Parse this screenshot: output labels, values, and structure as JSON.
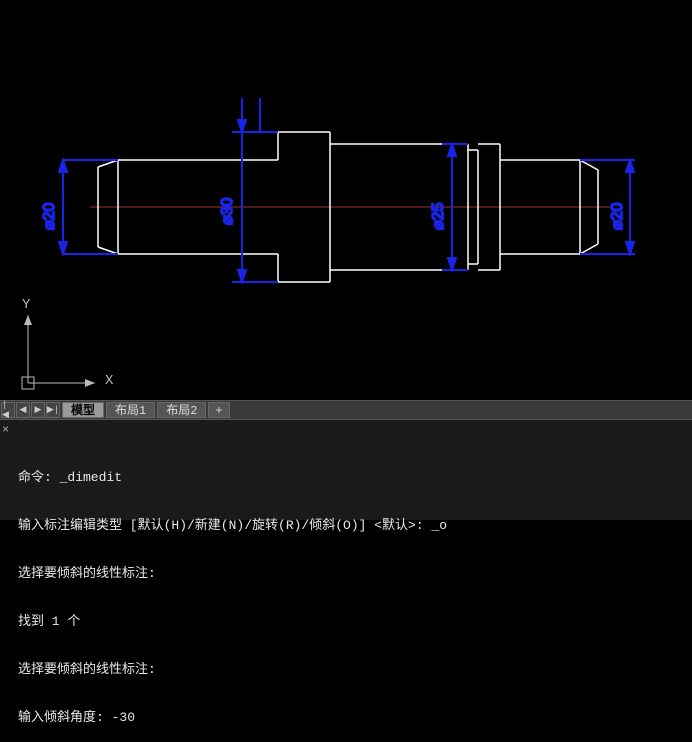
{
  "canvas": {
    "centerline_color": "#a03030",
    "geometry_color": "#ffffff",
    "dimension_color": "#1824e8"
  },
  "dimensions": {
    "d1": "⌀20",
    "d2": "⌀30",
    "d3": "⌀25",
    "d4": "⌀20"
  },
  "ucs": {
    "x_label": "X",
    "y_label": "Y"
  },
  "tabs": {
    "nav": {
      "first": "|◀",
      "prev": "◀",
      "next": "▶",
      "last": "▶|"
    },
    "model": "模型",
    "layout1": "布局1",
    "layout2": "布局2",
    "add": "+"
  },
  "command": {
    "close": "×",
    "lines": [
      "命令: _dimedit",
      "输入标注编辑类型 [默认(H)/新建(N)/旋转(R)/倾斜(O)] <默认>: _o",
      "选择要倾斜的线性标注:",
      "找到 1 个",
      "选择要倾斜的线性标注:",
      "输入倾斜角度: -30"
    ]
  }
}
